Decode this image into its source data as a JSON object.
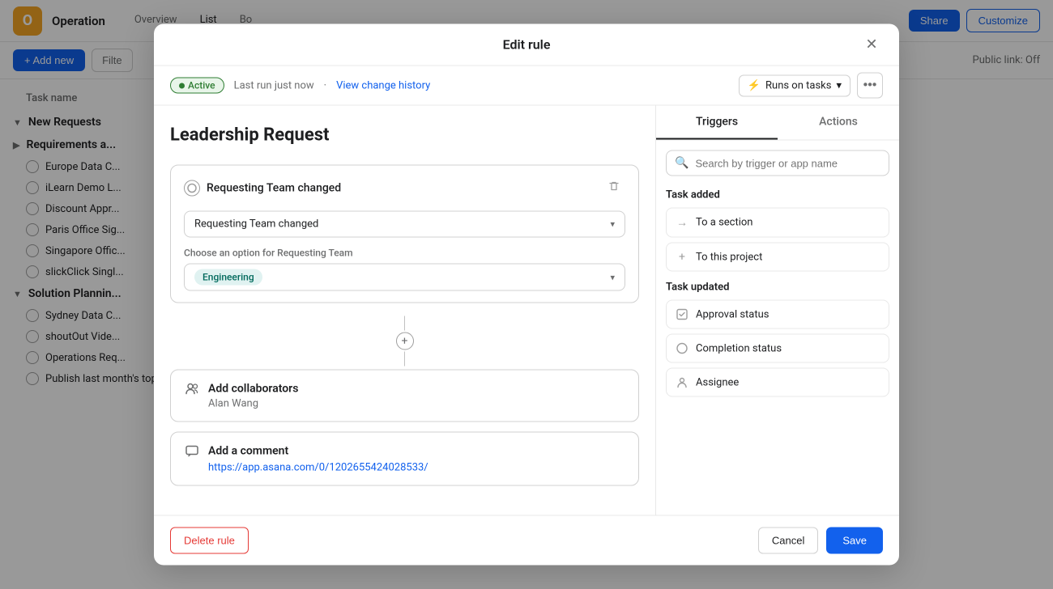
{
  "app": {
    "logo_letter": "O",
    "project_name": "Operation",
    "nav_items": [
      {
        "label": "Overview",
        "active": false
      },
      {
        "label": "List",
        "active": true
      },
      {
        "label": "Bo",
        "active": false
      }
    ],
    "topbar_right": {
      "share_label": "Share",
      "customize_label": "Customize"
    },
    "toolbar": {
      "add_new_label": "+ Add new",
      "filter_label": "Filte",
      "public_link_label": "Public link: Off"
    }
  },
  "sidebar": {
    "task_name_header": "Task name",
    "sections": [
      {
        "title": "New Requests",
        "tasks": []
      },
      {
        "title": "Requirements a...",
        "tasks": [
          "Europe Data C...",
          "iLearn Demo L...",
          "Discount Appr...",
          "Paris Office Sig...",
          "Singapore Offic...",
          "slickClick Singl..."
        ]
      },
      {
        "title": "Solution Plannin...",
        "tasks": [
          "Sydney Data C...",
          "shoutOut Vide...",
          "Operations Req...",
          "Publish last month's top sales calls for internal review"
        ]
      }
    ]
  },
  "modal": {
    "title": "Edit rule",
    "close_label": "×",
    "status": {
      "badge_label": "Active",
      "last_run_text": "Last run just now",
      "separator": "·",
      "view_history_label": "View change history",
      "runs_on_label": "Runs on tasks",
      "runs_on_icon": "⚡"
    },
    "rule_name": "Leadership Request",
    "trigger": {
      "title": "Requesting Team changed",
      "select_value": "Requesting Team changed",
      "field_label": "Choose an option for Requesting Team",
      "tag_value": "Engineering"
    },
    "actions": [
      {
        "icon_type": "people",
        "title": "Add collaborators",
        "subtitle": "Alan Wang"
      },
      {
        "icon_type": "comment",
        "title": "Add a comment",
        "link": "https://app.asana.com/0/1202655424028533/"
      }
    ],
    "footer": {
      "delete_label": "Delete rule",
      "cancel_label": "Cancel",
      "save_label": "Save"
    },
    "right_panel": {
      "tabs": [
        {
          "label": "Triggers",
          "active": true
        },
        {
          "label": "Actions",
          "active": false
        }
      ],
      "search_placeholder": "Search by trigger or app name",
      "task_added_section": {
        "title": "Task added",
        "items": [
          {
            "icon": "→",
            "label": "To a section"
          },
          {
            "icon": "+",
            "label": "To this project"
          }
        ]
      },
      "task_updated_section": {
        "title": "Task updated",
        "items": [
          {
            "icon": "✓",
            "label": "Approval status"
          },
          {
            "icon": "○",
            "label": "Completion status"
          },
          {
            "icon": "👤",
            "label": "Assignee"
          }
        ]
      }
    }
  }
}
